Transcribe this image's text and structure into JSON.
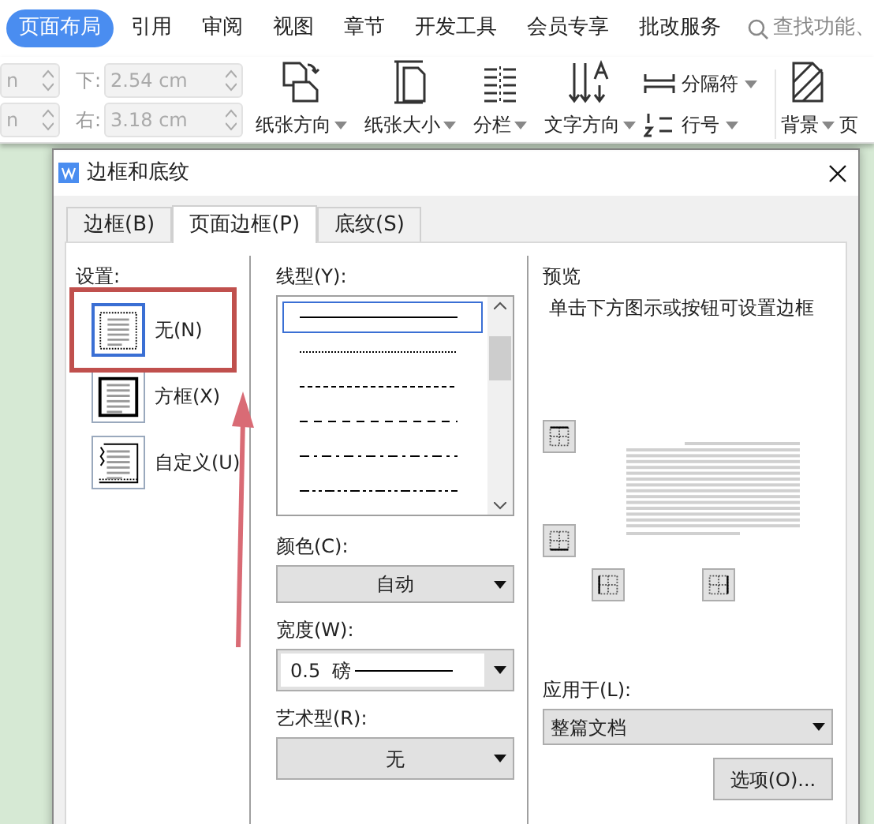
{
  "ribbon": {
    "tabs": [
      {
        "label": "页面布局",
        "selected": true
      },
      {
        "label": "引用",
        "selected": false
      },
      {
        "label": "审阅",
        "selected": false
      },
      {
        "label": "视图",
        "selected": false
      },
      {
        "label": "章节",
        "selected": false
      },
      {
        "label": "开发工具",
        "selected": false
      },
      {
        "label": "会员专享",
        "selected": false
      },
      {
        "label": "批改服务",
        "selected": false
      }
    ],
    "search": {
      "placeholder": "查找功能、"
    },
    "margin_fields": [
      {
        "value": "n"
      },
      {
        "label": "下:",
        "value": "2.54 cm"
      },
      {
        "value": "n"
      },
      {
        "label": "右:",
        "value": "3.18 cm"
      }
    ],
    "tools": [
      {
        "label": "纸张方向",
        "kind": "orientation"
      },
      {
        "label": "纸张大小",
        "kind": "size"
      },
      {
        "label": "分栏",
        "kind": "columns"
      },
      {
        "label": "文字方向",
        "kind": "direction"
      }
    ],
    "small_tools": [
      {
        "label": "分隔符",
        "kind": "breaks"
      },
      {
        "label": "行号",
        "kind": "linenum"
      }
    ],
    "more_tools": [
      {
        "label": "背景",
        "kind": "background"
      },
      {
        "label": "页",
        "kind": "cut"
      }
    ]
  },
  "dialog": {
    "title": "边框和底纹",
    "tabs": [
      {
        "label": "边框(B)",
        "selected": false
      },
      {
        "label": "页面边框(P)",
        "selected": true
      },
      {
        "label": "底纹(S)",
        "selected": false
      }
    ],
    "settings_label": "设置:",
    "settings": [
      {
        "label": "无(N)",
        "kind": "none",
        "selected": true
      },
      {
        "label": "方框(X)",
        "kind": "box",
        "selected": false
      },
      {
        "label": "自定义(U)",
        "kind": "custom",
        "selected": false
      }
    ],
    "line_style_label": "线型(Y):",
    "line_styles": [
      {
        "kind": "solid",
        "selected": true
      },
      {
        "kind": "dotted",
        "selected": false
      },
      {
        "kind": "dashed",
        "selected": false
      },
      {
        "kind": "longdash",
        "selected": false
      },
      {
        "kind": "dashdot",
        "selected": false
      },
      {
        "kind": "dashdotdot",
        "selected": false
      }
    ],
    "color_label": "颜色(C):",
    "color_value": "自动",
    "width_label": "宽度(W):",
    "width_value": "0.5  磅",
    "art_label": "艺术型(R):",
    "art_value": "无",
    "preview_label": "预览",
    "preview_hint": "单击下方图示或按钮可设置边框",
    "apply_label": "应用于(L):",
    "apply_value": "整篇文档",
    "options_button": "选项(O)..."
  }
}
